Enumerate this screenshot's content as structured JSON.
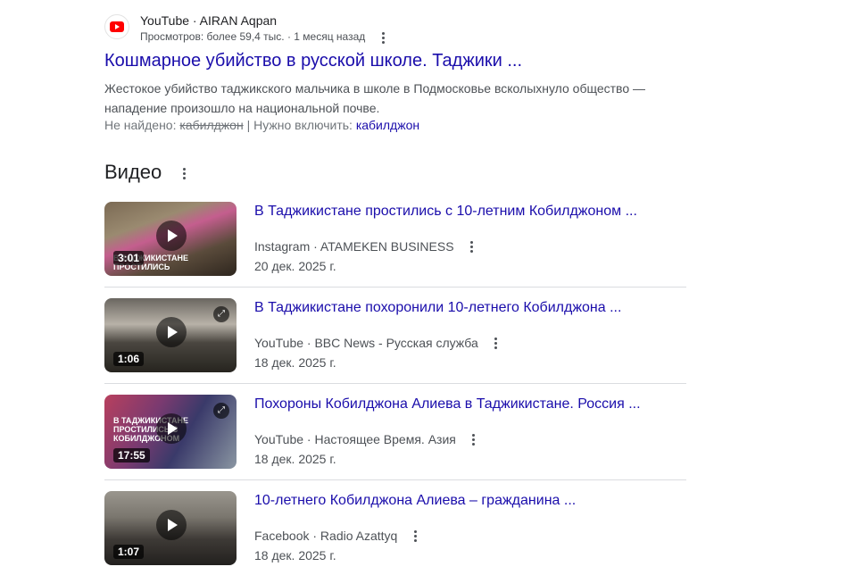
{
  "top_result": {
    "source_name": "YouTube · AIRAN Aqpan",
    "meta": "Просмотров: более 59,4 тыс. · 1 месяц назад",
    "title": "Кошмарное убийство в русской школе. Таджики ...",
    "snippet": "Жестокое убийство таджикского мальчика в школе в Подмосковье всколыхнуло общество — нападение произошло на национальной почве.",
    "missing_label": "Не найдено:",
    "missing_term": "кабилджон",
    "include_label": "| Нужно включить:",
    "include_term": "кабилджон",
    "logo_icon": "youtube-icon"
  },
  "videos_section": {
    "heading": "Видео",
    "items": [
      {
        "title": "В Таджикистане простились с 10-летним Кобилджоном ...",
        "source": "Instagram · ATAMEKEN BUSINESS",
        "date": "20 дек. 2025 г.",
        "duration": "3:01",
        "caption": "В таджикистане простились",
        "colors": [
          "#6b5a47",
          "#c25a8a",
          "#3a3128"
        ]
      },
      {
        "title": "В Таджикистане похоронили 10-летнего Кобилджона ...",
        "source": "YouTube · BBC News - Русская служба",
        "date": "18 дек. 2025 г.",
        "duration": "1:06",
        "caption": "",
        "colors": [
          "#5a5650",
          "#a9a39b",
          "#2e2c2a"
        ]
      },
      {
        "title": "Похороны Кобилджона Алиева в Таджикистане. Россия ...",
        "source": "YouTube · Настоящее Время. Азия",
        "date": "18 дек. 2025 г.",
        "duration": "17:55",
        "caption": "В таджикистане простились с кобилджоном",
        "colors": [
          "#b0405a",
          "#3a3a6a",
          "#7a8a99"
        ]
      },
      {
        "title": "10-летнего Кобилджона Алиева – гражданина ...",
        "source": "Facebook · Radio Azattyq",
        "date": "18 дек. 2025 г.",
        "duration": "1:07",
        "caption": "",
        "colors": [
          "#8a8680",
          "#4a4640",
          "#2a2826"
        ]
      }
    ]
  }
}
